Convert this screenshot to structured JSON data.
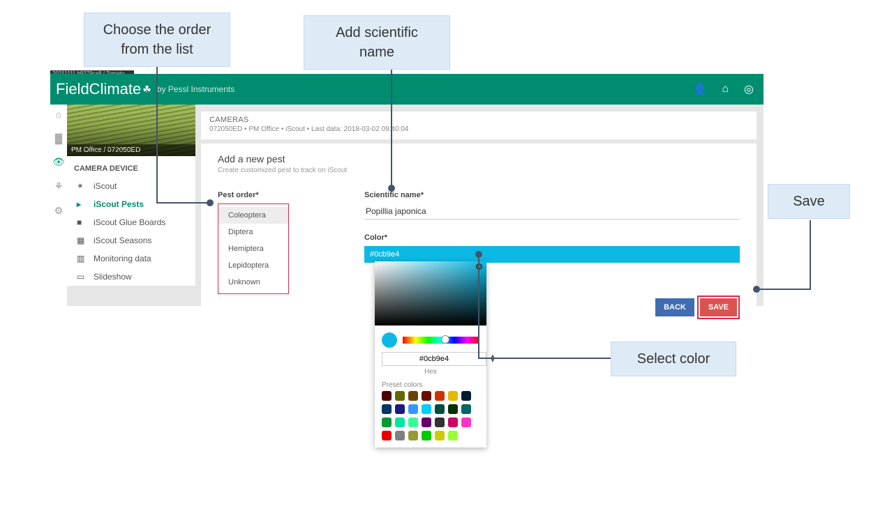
{
  "callouts": {
    "order": "Choose the order\nfrom the list",
    "name": "Add scientific name",
    "save": "Save",
    "color": "Select color"
  },
  "breadcrumb_top": "20211111.b9279ca8 / Tomato",
  "logo": "FieldClimate",
  "sublogo": "by Pessl Instruments",
  "field_caption": "PM Office / 072050ED",
  "sidepanel": {
    "title": "CAMERA DEVICE",
    "items": [
      {
        "label": "iScout"
      },
      {
        "label": "iScout Pests"
      },
      {
        "label": "iScout Glue Boards"
      },
      {
        "label": "iScout Seasons"
      },
      {
        "label": "Monitoring data"
      },
      {
        "label": "Slideshow"
      }
    ]
  },
  "content": {
    "heading": "CAMERAS",
    "meta": "072050ED • PM Office • iScout • Last data: 2018-03-02 09:40:04",
    "section_title": "Add a new pest",
    "section_sub": "Create customized pest to track on iScout"
  },
  "form": {
    "order_label": "Pest order*",
    "orders": [
      "Coleoptera",
      "Diptera",
      "Hemiptera",
      "Lepidoptera",
      "Unknown"
    ],
    "name_label": "Scientific name*",
    "name_value": "Popillia japonica",
    "color_label": "Color*",
    "color_value": "#0cb9e4"
  },
  "buttons": {
    "back": "BACK",
    "save": "SAVE"
  },
  "picker": {
    "hex": "#0cb9e4",
    "hex_label": "Hex",
    "preset_label": "Preset colors",
    "presets": [
      "#4d0000",
      "#666600",
      "#664400",
      "#661100",
      "#cc3300",
      "#e6b800",
      "",
      "#001a33",
      "#003366",
      "#1a1a80",
      "#3399ff",
      "#00ccff",
      "#004d40",
      "",
      "#003300",
      "#006666",
      "#009933",
      "#00e6a1",
      "#33ff99",
      "#660066",
      "",
      "#333333",
      "#cc0066",
      "#ff33cc",
      "#e60000",
      "#808080",
      "#999933",
      "",
      "#00cc00",
      "#cccc00",
      "#99ff33"
    ]
  }
}
